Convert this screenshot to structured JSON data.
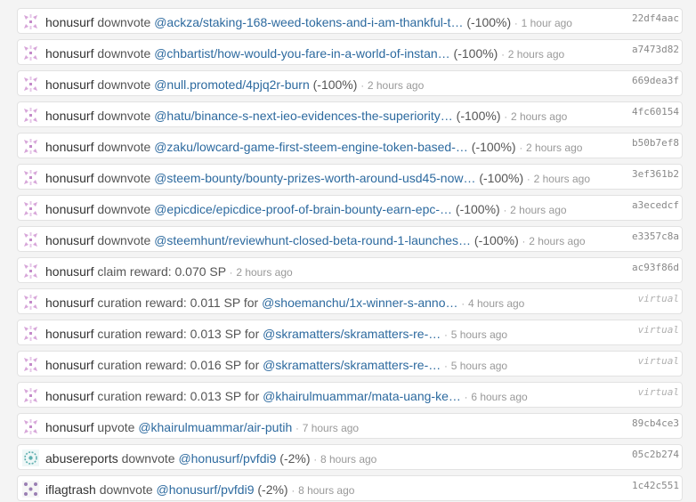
{
  "colors": {
    "link": "#2d6a9f",
    "text": "#555555",
    "muted": "#999999",
    "avatar_accent": "#d7a6d9"
  },
  "rows": [
    {
      "avatar": "honusurf-avatar",
      "user": "honusurf",
      "action": "downvote",
      "pre": "",
      "link": "@ackza/staking-168-weed-tokens-and-i-am-thankful-t…",
      "suffix": " (-100%)",
      "time": "1 hour ago",
      "hash": "22df4aac"
    },
    {
      "avatar": "honusurf-avatar",
      "user": "honusurf",
      "action": "downvote",
      "pre": "",
      "link": "@chbartist/how-would-you-fare-in-a-world-of-instan…",
      "suffix": " (-100%)",
      "time": "2 hours ago",
      "hash": "a7473d82"
    },
    {
      "avatar": "honusurf-avatar",
      "user": "honusurf",
      "action": "downvote",
      "pre": "",
      "link": "@null.promoted/4pjq2r-burn",
      "suffix": " (-100%)",
      "time": "2 hours ago",
      "hash": "669dea3f"
    },
    {
      "avatar": "honusurf-avatar",
      "user": "honusurf",
      "action": "downvote",
      "pre": "",
      "link": "@hatu/binance-s-next-ieo-evidences-the-superiority…",
      "suffix": " (-100%)",
      "time": "2 hours ago",
      "hash": "4fc60154"
    },
    {
      "avatar": "honusurf-avatar",
      "user": "honusurf",
      "action": "downvote",
      "pre": "",
      "link": "@zaku/lowcard-game-first-steem-engine-token-based-…",
      "suffix": " (-100%)",
      "time": "2 hours ago",
      "hash": "b50b7ef8"
    },
    {
      "avatar": "honusurf-avatar",
      "user": "honusurf",
      "action": "downvote",
      "pre": "",
      "link": "@steem-bounty/bounty-prizes-worth-around-usd45-now…",
      "suffix": " (-100%)",
      "time": "2 hours ago",
      "hash": "3ef361b2"
    },
    {
      "avatar": "honusurf-avatar",
      "user": "honusurf",
      "action": "downvote",
      "pre": "",
      "link": "@epicdice/epicdice-proof-of-brain-bounty-earn-epc-…",
      "suffix": " (-100%)",
      "time": "2 hours ago",
      "hash": "a3ecedcf"
    },
    {
      "avatar": "honusurf-avatar",
      "user": "honusurf",
      "action": "downvote",
      "pre": "",
      "link": "@steemhunt/reviewhunt-closed-beta-round-1-launches…",
      "suffix": " (-100%)",
      "time": "2 hours ago",
      "hash": "e3357c8a"
    },
    {
      "avatar": "honusurf-avatar",
      "user": "honusurf",
      "action": "claim reward: 0.070 SP",
      "pre": "",
      "link": "",
      "suffix": "",
      "time": "2 hours ago",
      "hash": "ac93f86d"
    },
    {
      "avatar": "honusurf-avatar",
      "user": "honusurf",
      "action": "curation reward: 0.011 SP",
      "pre": "for",
      "link": "@shoemanchu/1x-winner-s-anno…",
      "suffix": "",
      "time": "4 hours ago",
      "hash": "virtual"
    },
    {
      "avatar": "honusurf-avatar",
      "user": "honusurf",
      "action": "curation reward: 0.013 SP",
      "pre": "for",
      "link": "@skramatters/skramatters-re-…",
      "suffix": "",
      "time": "5 hours ago",
      "hash": "virtual"
    },
    {
      "avatar": "honusurf-avatar",
      "user": "honusurf",
      "action": "curation reward: 0.016 SP",
      "pre": "for",
      "link": "@skramatters/skramatters-re-…",
      "suffix": "",
      "time": "5 hours ago",
      "hash": "virtual"
    },
    {
      "avatar": "honusurf-avatar",
      "user": "honusurf",
      "action": "curation reward: 0.013 SP",
      "pre": "for",
      "link": "@khairulmuammar/mata-uang-ke…",
      "suffix": "",
      "time": "6 hours ago",
      "hash": "virtual"
    },
    {
      "avatar": "honusurf-avatar",
      "user": "honusurf",
      "action": "upvote",
      "pre": "",
      "link": "@khairulmuammar/air-putih",
      "suffix": "",
      "time": "7 hours ago",
      "hash": "89cb4ce3"
    },
    {
      "avatar": "abusereports-avatar",
      "user": "abusereports",
      "action": "downvote",
      "pre": "",
      "link": "@honusurf/pvfdi9",
      "suffix": " (-2%)",
      "time": "8 hours ago",
      "hash": "05c2b274"
    },
    {
      "avatar": "iflagtrash-avatar",
      "user": "iflagtrash",
      "action": "downvote",
      "pre": "",
      "link": "@honusurf/pvfdi9",
      "suffix": " (-2%)",
      "time": "8 hours ago",
      "hash": "1c42c551"
    }
  ]
}
